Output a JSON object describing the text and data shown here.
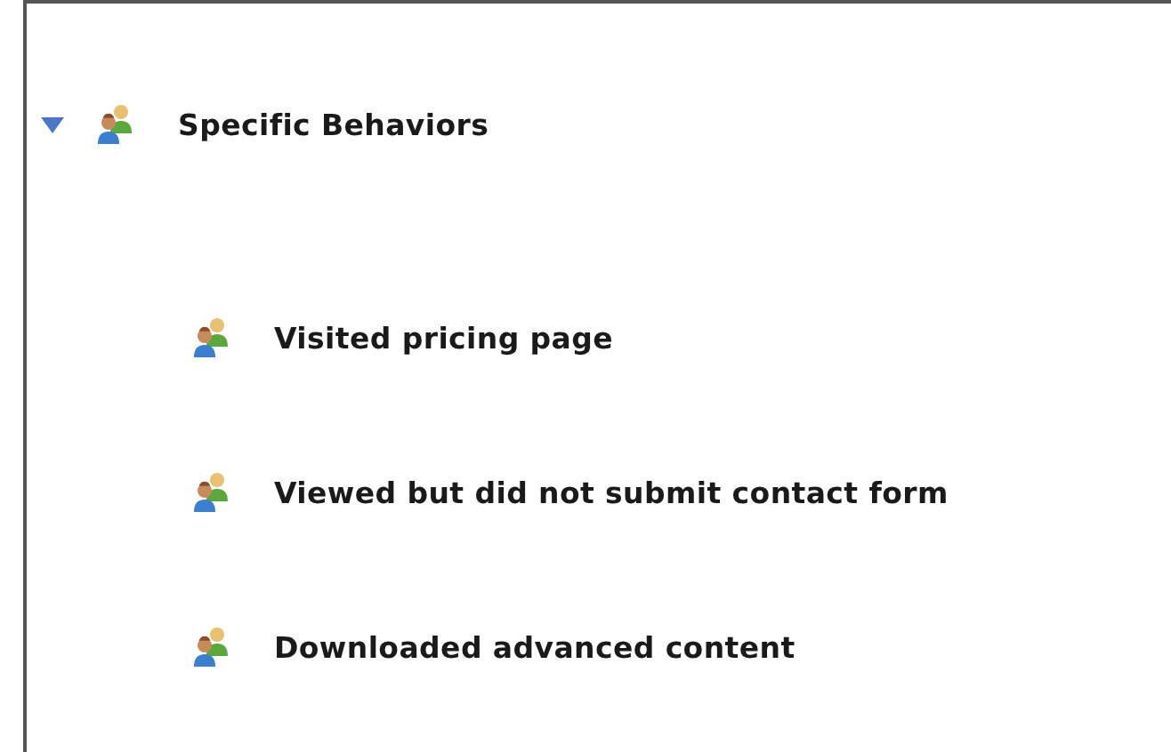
{
  "tree": [
    {
      "label": "Specific Behaviors",
      "expanded": true,
      "children": [
        {
          "label": "Visited pricing page"
        },
        {
          "label": "Viewed but did not submit contact form"
        },
        {
          "label": "Downloaded advanced content"
        }
      ]
    }
  ]
}
